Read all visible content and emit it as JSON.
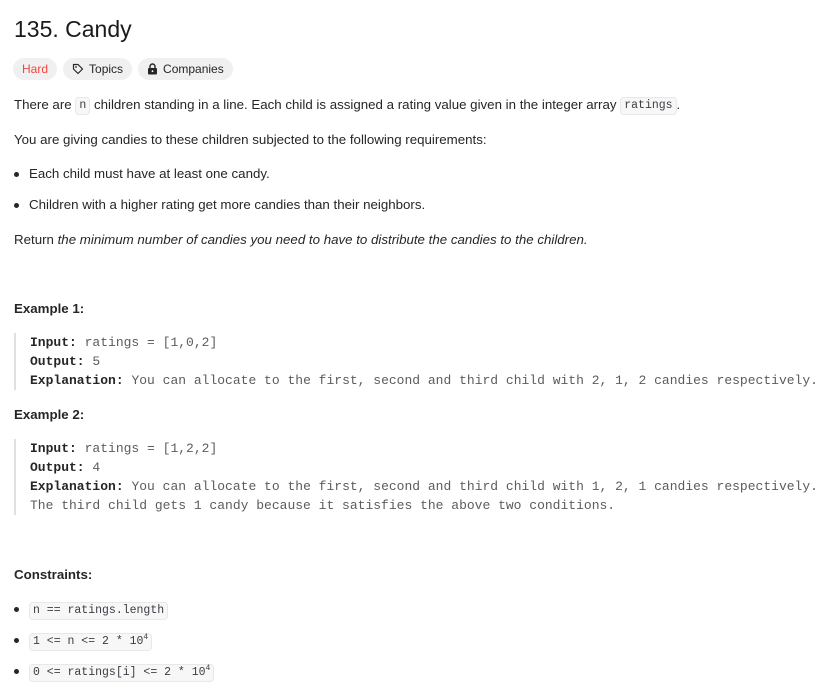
{
  "problem": {
    "title": "135. Candy",
    "difficulty": "Hard",
    "topics_label": "Topics",
    "companies_label": "Companies"
  },
  "description": {
    "line1_pre": "There are ",
    "line1_code_n": "n",
    "line1_mid": " children standing in a line. Each child is assigned a rating value given in the integer array ",
    "line1_code_ratings": "ratings",
    "line1_post": ".",
    "line2": "You are giving candies to these children subjected to the following requirements:",
    "req1": "Each child must have at least one candy.",
    "req2": "Children with a higher rating get more candies than their neighbors.",
    "return_pre": "Return ",
    "return_em": "the minimum number of candies you need to have to distribute the candies to the children."
  },
  "examples": [
    {
      "heading": "Example 1:",
      "input_label": "Input:",
      "input_value": "ratings = [1,0,2]",
      "output_label": "Output:",
      "output_value": "5",
      "explanation_label": "Explanation:",
      "explanation_value": "You can allocate to the first, second and third child with 2, 1, 2 candies respectively."
    },
    {
      "heading": "Example 2:",
      "input_label": "Input:",
      "input_value": "ratings = [1,2,2]",
      "output_label": "Output:",
      "output_value": "4",
      "explanation_label": "Explanation:",
      "explanation_value": "You can allocate to the first, second and third child with 1, 2, 1 candies respectively.",
      "explanation_line2": "The third child gets 1 candy because it satisfies the above two conditions."
    }
  ],
  "constraints": {
    "heading": "Constraints:",
    "c1": "n == ratings.length",
    "c2_base": "1 <= n <= 2 * 10",
    "c2_exp": "4",
    "c3_base": "0 <= ratings[i] <= 2 * 10",
    "c3_exp": "4"
  }
}
